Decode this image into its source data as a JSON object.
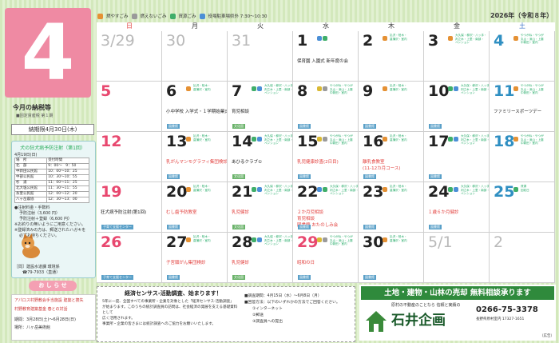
{
  "month": "4",
  "year_label": "2026年（令和８年）",
  "legend": [
    {
      "label": "燃やすごみ",
      "color": "#e08a3a"
    },
    {
      "label": "燃えないごみ",
      "color": "#9a9a9a"
    },
    {
      "label": "資源ごみ",
      "color": "#3aa05a"
    },
    {
      "label": "役場駐車場県外 7:30～10:30",
      "color": "#3a72c8"
    }
  ],
  "weekdays": [
    "日",
    "月",
    "火",
    "水",
    "木",
    "金",
    "土"
  ],
  "sidebar": {
    "tax_title": "今月の納税等",
    "tax_sub": "■固定資産税 第１期",
    "due": "納期限4月30日(木)",
    "vacc_title": "犬の狂犬病予防注射（第1回）",
    "vacc_date": "4月19日(日)",
    "vacc_head": [
      "場　所",
      "受付時間"
    ],
    "vacc_rows": [
      [
        "北　部",
        "9：00～　9：50"
      ],
      [
        "中新田公民館",
        "10：00～10：25"
      ],
      [
        "中部公民館",
        "10：30～10：55"
      ],
      [
        "杉　浦",
        "11：00～11：25"
      ],
      [
        "北大塩公民館",
        "11：30～11：55"
      ],
      [
        "糸萱公民館",
        "12：00～12：20"
      ],
      [
        "八ヶ岳農協",
        "12：30～13：00"
      ]
    ],
    "notes": [
      "●注射料金・手数料",
      "予防注射（3,600 円）",
      "予防注射＋登録（6,600 円）",
      "※お釣りの無いようにご用意ください。",
      "※登録済みの方は、郵送されたハガキを",
      "必ずお持ちください。"
    ],
    "contact": "［問］建設水道課 環境係",
    "contact_tel": "☎79-7933（直通）",
    "pill": "お し ら せ",
    "s1": "アパロス村野教会手当施設 建築と捜失",
    "s2": "村野教育建築基金 春との対話",
    "s3": "期間：3月28日(土)～6月28日(日)",
    "s4": "場所：八ヶ岳美術館"
  },
  "census": {
    "title": "経済センサス-活動調査、始まります！",
    "body": [
      "5年に一度、全国すべての事業所・企業を対象とした「経済センサス-活動調査」",
      "が始まります。このうちの統計調査員の訪問は、社会経済の発展を支える基礎資料として",
      "広く活用されます。",
      "事業所・企業の皆さまには統計調査へのご協力をお願いいたします。"
    ],
    "period": "■調査期間：4月15日（水）～6月8日（月）",
    "method": "■回答方法：以下のいずれかの方法でご回答ください。",
    "m1": "①インターネット",
    "m2": "②郵送",
    "m3": "③調査員への提出"
  },
  "ad": {
    "headline": "土地・建物・山林の売却 無料相談承ります",
    "sub": "原村の不動産のことなら 信頼と実績の",
    "tel": "0266-75-3378",
    "addr": "長野県原村室内 17327-1651",
    "name": "石井企画",
    "ad_mark": "（広告）"
  },
  "weeks": [
    [
      {
        "d": "3/29",
        "dim": true
      },
      {
        "d": "30",
        "dim": true
      },
      {
        "d": "31",
        "dim": true
      },
      {
        "d": "1",
        "g": [
          "b",
          "g"
        ],
        "gt": "9",
        "e": [
          "保育園 入園式 新年度の会"
        ]
      },
      {
        "d": "2",
        "g": [
          "o"
        ],
        "gt": "2"
      },
      {
        "d": "3",
        "g": [
          "o"
        ],
        "gt": "3"
      },
      {
        "d": "4",
        "sat": true,
        "g": [
          "o"
        ],
        "gt": "1"
      }
    ],
    [
      {
        "d": "5",
        "sun": true
      },
      {
        "d": "6",
        "g": [
          "o"
        ],
        "gt": "2",
        "e": [
          "小中学校 入学式・１学期始業式"
        ],
        "tag": "図書館"
      },
      {
        "d": "7",
        "g": [
          "g",
          "b"
        ],
        "gt": "3",
        "e": [
          "育児相談"
        ],
        "tag": "文化園"
      },
      {
        "d": "8",
        "g": [
          "y",
          "gray"
        ],
        "gt": "1",
        "tag": "図書館"
      },
      {
        "d": "9",
        "g": [
          "o"
        ],
        "gt": "2",
        "tag": "図書館"
      },
      {
        "d": "10",
        "g": [
          "g",
          "b"
        ],
        "gt": "3",
        "tag": "図書館"
      },
      {
        "d": "11",
        "sat": true,
        "g": [
          "o"
        ],
        "gt": "1",
        "e": [
          "ファミリースポーツデー"
        ]
      }
    ],
    [
      {
        "d": "12",
        "sun": true
      },
      {
        "d": "13",
        "g": [
          "o"
        ],
        "gt": "2",
        "e": [
          "乳がんマンモグラフィ集団検診"
        ],
        "red": true,
        "tag": "図書館"
      },
      {
        "d": "14",
        "g": [
          "g",
          "b"
        ],
        "gt": "3",
        "e": [
          "あひるクラブ①"
        ],
        "tag": "文化園"
      },
      {
        "d": "15",
        "g": [
          "y",
          "gray"
        ],
        "gt": "1",
        "e": [
          "乳児健康診査(2日目)"
        ],
        "red": true,
        "tag": "図書館"
      },
      {
        "d": "16",
        "g": [
          "o"
        ],
        "gt": "2",
        "e": [
          "離乳食教室",
          "(11-12カ月コース)"
        ],
        "red": true,
        "tag": "図書館"
      },
      {
        "d": "17",
        "g": [
          "g",
          "b"
        ],
        "gt": "3",
        "tag": "図書館"
      },
      {
        "d": "18",
        "sat": true,
        "g": [
          "o"
        ],
        "gt": "1"
      }
    ],
    [
      {
        "d": "19",
        "sun": true,
        "e": [
          "狂犬病予防注射(第1回)"
        ],
        "tag": "子育て支援センター"
      },
      {
        "d": "20",
        "g": [
          "o"
        ],
        "gt": "2",
        "e": [
          "むし歯予防教室"
        ],
        "red": true,
        "tag": "図書館"
      },
      {
        "d": "21",
        "g": [
          "g",
          "b"
        ],
        "gt": "3",
        "e": [
          "乳児健診"
        ],
        "red": true,
        "tag": "文化園"
      },
      {
        "d": "22",
        "g": [
          "b",
          "g"
        ],
        "gt": "3",
        "e": [
          "２か月児相談",
          "育児相談",
          "図書館 おたのしみ会"
        ],
        "red": true,
        "tag": "図書館"
      },
      {
        "d": "23",
        "g": [
          "o"
        ],
        "gt": "2",
        "tag": "図書館"
      },
      {
        "d": "24",
        "g": [
          "g",
          "b"
        ],
        "gt": "3",
        "e": [
          "１歳６か月健診"
        ],
        "red": true,
        "tag": "図書館"
      },
      {
        "d": "25",
        "sat": true,
        "g": [
          "g"
        ],
        "gt": "4"
      }
    ],
    [
      {
        "d": "26",
        "sun": true,
        "tag": "子育て支援センター"
      },
      {
        "d": "27",
        "g": [
          "o"
        ],
        "gt": "2",
        "e": [
          "子宮頸がん集団検診"
        ],
        "red": true,
        "tag": "図書館"
      },
      {
        "d": "28",
        "g": [
          "g",
          "b"
        ],
        "gt": "3",
        "e": [
          "乳児健診"
        ],
        "red": true,
        "tag": "文化園"
      },
      {
        "d": "29",
        "hol": true,
        "g": [
          "y",
          "gray"
        ],
        "gt": "1",
        "e": [
          "昭和の日"
        ],
        "red": true,
        "tag": "図書館"
      },
      {
        "d": "30",
        "g": [
          "o"
        ],
        "gt": "2",
        "tag": "図書館"
      },
      {
        "d": "5/1",
        "dim": true
      },
      {
        "d": "2",
        "dim": true
      }
    ]
  ],
  "garbage_text": {
    "1": "やつがね・やつが\n丸山・深山・上藤\n中新田・室内",
    "2": "払沢・柏木・\n菖蒲沢・室内",
    "3": "大久保・柳沢・八ッ手・\n判之木・上里・南部・\nペンション",
    "4": "資源\n回収日"
  },
  "colors": {
    "o": "#e59134",
    "g": "#3fae6a",
    "b": "#4b8fd6",
    "y": "#d9b934",
    "gray": "#9a9a9a"
  }
}
